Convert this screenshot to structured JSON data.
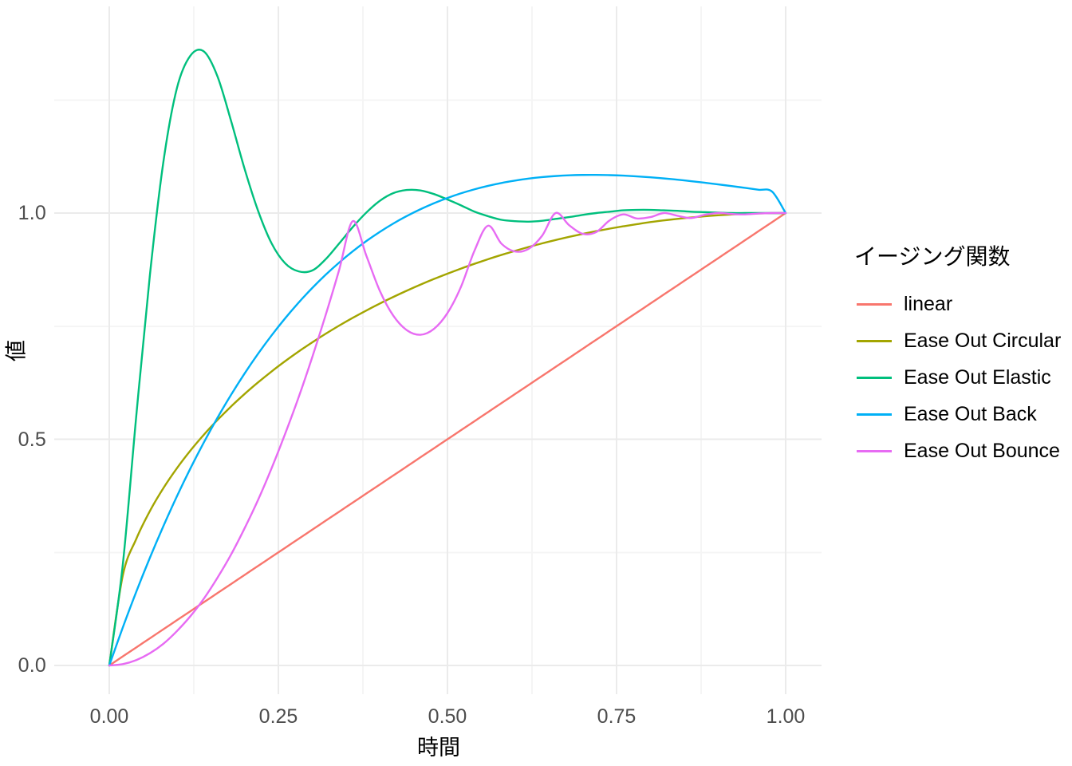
{
  "chart_data": {
    "type": "line",
    "title": "",
    "xlabel": "時間",
    "ylabel": "値",
    "xlim": [
      -0.05,
      1.05
    ],
    "ylim": [
      -0.06,
      1.42
    ],
    "grid": true,
    "legend_position": "right",
    "legend_title": "イージング関数",
    "x_ticks": [
      "0.00",
      "0.25",
      "0.50",
      "0.75",
      "1.00"
    ],
    "x_tick_values": [
      0.0,
      0.25,
      0.5,
      0.75,
      1.0
    ],
    "y_ticks": [
      "0.0",
      "0.5",
      "1.0"
    ],
    "y_tick_values": [
      0.0,
      0.5,
      1.0
    ],
    "x": [
      0.0,
      0.02,
      0.04,
      0.06,
      0.08,
      0.1,
      0.12,
      0.14,
      0.16,
      0.18,
      0.2,
      0.22,
      0.24,
      0.26,
      0.28,
      0.3,
      0.32,
      0.34,
      0.36,
      0.38,
      0.4,
      0.42,
      0.44,
      0.46,
      0.48,
      0.5,
      0.52,
      0.54,
      0.56,
      0.58,
      0.6,
      0.62,
      0.64,
      0.66,
      0.68,
      0.7,
      0.72,
      0.74,
      0.76,
      0.78,
      0.8,
      0.82,
      0.84,
      0.86,
      0.88,
      0.9,
      0.92,
      0.94,
      0.96,
      0.98,
      1.0
    ],
    "series": [
      {
        "name": "linear",
        "color": "#F8766D",
        "values": [
          0.0,
          0.02,
          0.04,
          0.06,
          0.08,
          0.1,
          0.12,
          0.14,
          0.16,
          0.18,
          0.2,
          0.22,
          0.24,
          0.26,
          0.28,
          0.3,
          0.32,
          0.34,
          0.36,
          0.38,
          0.4,
          0.42,
          0.44,
          0.46,
          0.48,
          0.5,
          0.52,
          0.54,
          0.56,
          0.58,
          0.6,
          0.62,
          0.64,
          0.66,
          0.68,
          0.7,
          0.72,
          0.74,
          0.76,
          0.78,
          0.8,
          0.82,
          0.84,
          0.86,
          0.88,
          0.9,
          0.92,
          0.94,
          0.96,
          0.98,
          1.0
        ]
      },
      {
        "name": "Ease Out Circular",
        "color": "#A3A500",
        "values": [
          0.0,
          0.199,
          0.28,
          0.3412,
          0.3919,
          0.4359,
          0.475,
          0.5103,
          0.5426,
          0.5724,
          0.6,
          0.6257,
          0.6499,
          0.6726,
          0.694,
          0.7141,
          0.7332,
          0.7513,
          0.7684,
          0.7846,
          0.8,
          0.8146,
          0.8285,
          0.8417,
          0.8542,
          0.866,
          0.8773,
          0.8879,
          0.898,
          0.9075,
          0.9165,
          0.925,
          0.933,
          0.9404,
          0.9474,
          0.9539,
          0.96,
          0.9656,
          0.9707,
          0.9754,
          0.98,
          0.9838,
          0.9872,
          0.9902,
          0.9928,
          0.995,
          0.9968,
          0.9982,
          0.9992,
          0.9998,
          1.0
        ]
      },
      {
        "name": "Ease Out Elastic",
        "color": "#00BF7D",
        "values": [
          0.0,
          0.223,
          0.553,
          0.862,
          1.113,
          1.276,
          1.348,
          1.357,
          1.302,
          1.204,
          1.098,
          1.005,
          0.933,
          0.889,
          0.871,
          0.873,
          0.898,
          0.933,
          0.969,
          1.001,
          1.027,
          1.044,
          1.051,
          1.05,
          1.042,
          1.03,
          1.017,
          1.003,
          0.993,
          0.985,
          0.982,
          0.981,
          0.983,
          0.987,
          0.991,
          0.996,
          1.0,
          1.003,
          1.006,
          1.007,
          1.007,
          1.006,
          1.005,
          1.003,
          1.002,
          1.001,
          1.0,
          1.0,
          1.0,
          1.0,
          1.0
        ]
      },
      {
        "name": "Ease Out Back",
        "color": "#00B0F6",
        "values": [
          0.0,
          0.084,
          0.1633,
          0.2379,
          0.308,
          0.3739,
          0.4357,
          0.4935,
          0.5476,
          0.5981,
          0.6452,
          0.689,
          0.7296,
          0.7673,
          0.8021,
          0.8342,
          0.8637,
          0.8907,
          0.9154,
          0.938,
          0.9584,
          0.9769,
          0.9935,
          1.0084,
          1.0216,
          1.0333,
          1.0436,
          1.0525,
          1.0601,
          1.0665,
          1.0718,
          1.0761,
          1.0794,
          1.0818,
          1.0834,
          1.0842,
          1.0843,
          1.0838,
          1.0827,
          1.0811,
          1.079,
          1.0765,
          1.0737,
          1.0705,
          1.0671,
          1.0634,
          1.0596,
          1.0556,
          1.0515,
          1.0473,
          1.0
        ]
      },
      {
        "name": "Ease Out Bounce",
        "color": "#E76BF3",
        "values": [
          0.0,
          0.003,
          0.012,
          0.027,
          0.048,
          0.076,
          0.109,
          0.148,
          0.194,
          0.245,
          0.303,
          0.366,
          0.436,
          0.512,
          0.593,
          0.681,
          0.775,
          0.875,
          0.982,
          0.906,
          0.828,
          0.773,
          0.741,
          0.731,
          0.744,
          0.779,
          0.837,
          0.917,
          0.972,
          0.932,
          0.915,
          0.921,
          0.95,
          1.0,
          0.973,
          0.954,
          0.958,
          0.984,
          0.997,
          0.988,
          0.991,
          1.0,
          0.994,
          0.989,
          0.996,
          1.0,
          0.998,
          0.997,
          0.999,
          1.0,
          1.0
        ]
      }
    ]
  },
  "legend": {
    "title": "イージング関数",
    "items": [
      {
        "label": "linear",
        "color": "#F8766D"
      },
      {
        "label": "Ease Out Circular",
        "color": "#A3A500"
      },
      {
        "label": "Ease Out Elastic",
        "color": "#00BF7D"
      },
      {
        "label": "Ease Out Back",
        "color": "#00B0F6"
      },
      {
        "label": "Ease Out Bounce",
        "color": "#E76BF3"
      }
    ]
  },
  "axes": {
    "x_title": "時間",
    "y_title": "値",
    "x_tick_labels": [
      "0.00",
      "0.25",
      "0.50",
      "0.75",
      "1.00"
    ],
    "y_tick_labels": [
      "0.0",
      "0.5",
      "1.0"
    ]
  },
  "style": {
    "panel_background": "#FFFFFF",
    "major_grid_color": "#EBEBEB",
    "minor_grid_color": "#F5F5F5",
    "tick_label_color": "#4D4D4D",
    "title_color": "#000000"
  }
}
